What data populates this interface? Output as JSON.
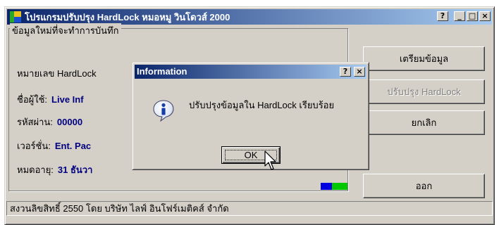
{
  "window": {
    "title": "โปรแกรมปรับปรุง HardLock หมอหมู วินโดวส์ 2000",
    "controls": {
      "help": "?",
      "minimize": "_",
      "maximize": "□",
      "close": "×"
    }
  },
  "group": {
    "legend": "ข้อมูลใหม่ที่จะทำการบันทึก",
    "fields": [
      {
        "label": "หมายเลข HardLock",
        "value": ""
      },
      {
        "label": "ชื่อผู้ใช้:",
        "value": "Live Inf"
      },
      {
        "label": "รหัสผ่าน:",
        "value": "00000"
      },
      {
        "label": "เวอร์ชั่น:",
        "value": "Ent. Pac"
      },
      {
        "label": "หมดอายุ:",
        "value": "31 ธันวา"
      }
    ]
  },
  "buttons": {
    "prepare": "เตรียมข้อมูล",
    "update": "ปรับปรุง HardLock",
    "cancel": "ยกเลิก",
    "exit": "ออก"
  },
  "status": "สงวนลิขสิทธิ์ 2550 โดย บริษัท ไลฟ์ อินโฟร์เมติคส์ จำกัด",
  "dialog": {
    "title": "Information",
    "message": "ปรับปรุงข้อมูลใน HardLock เรียบร้อย",
    "ok_label": "OK",
    "icon": "information-icon",
    "controls": {
      "help": "?",
      "close": "×"
    }
  },
  "colors": {
    "title_start": "#0a246a",
    "title_end": "#a6caf0",
    "value_text": "#000080",
    "face": "#d4d0c8"
  }
}
